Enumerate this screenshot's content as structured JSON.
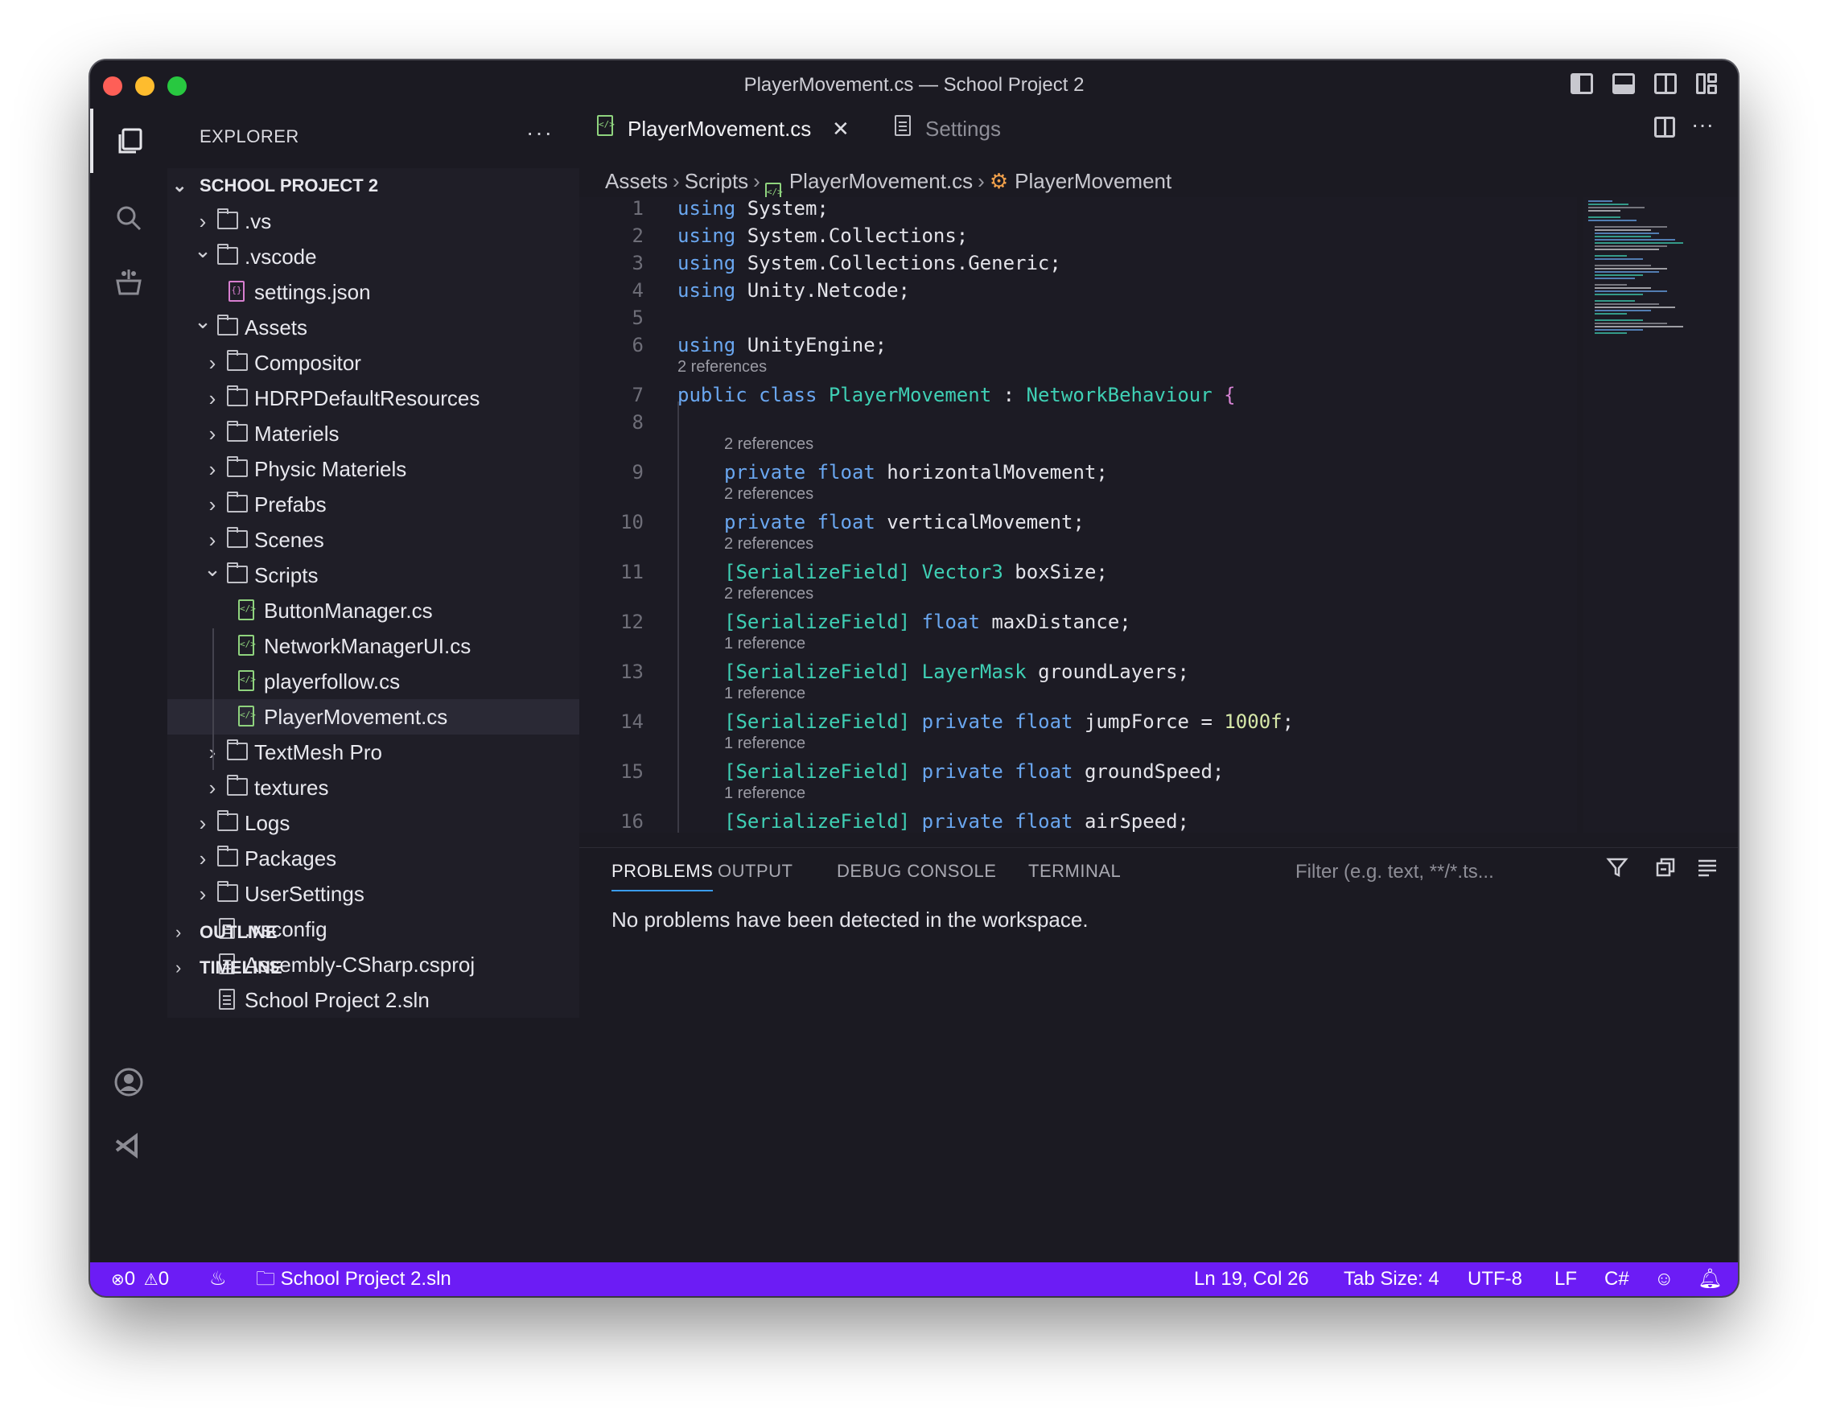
{
  "window": {
    "title": "PlayerMovement.cs — School Project 2"
  },
  "activity_bar": {
    "items": [
      "explorer-icon",
      "search-icon",
      "extensions-icon",
      "account-icon",
      "visual-studio-icon"
    ]
  },
  "explorer": {
    "header": "EXPLORER",
    "more": "···",
    "root": "SCHOOL PROJECT 2",
    "tree": [
      {
        "label": ".vs",
        "type": "folder",
        "expanded": false
      },
      {
        "label": ".vscode",
        "type": "folder",
        "expanded": true
      },
      {
        "label": "settings.json",
        "type": "json"
      },
      {
        "label": "Assets",
        "type": "folder",
        "expanded": true
      },
      {
        "label": "Compositor",
        "type": "folder",
        "expanded": false
      },
      {
        "label": "HDRPDefaultResources",
        "type": "folder",
        "expanded": false
      },
      {
        "label": "Materiels",
        "type": "folder",
        "expanded": false
      },
      {
        "label": "Physic Materiels",
        "type": "folder",
        "expanded": false
      },
      {
        "label": "Prefabs",
        "type": "folder",
        "expanded": false
      },
      {
        "label": "Scenes",
        "type": "folder",
        "expanded": false
      },
      {
        "label": "Scripts",
        "type": "folder",
        "expanded": true
      },
      {
        "label": "ButtonManager.cs",
        "type": "cs"
      },
      {
        "label": "NetworkManagerUI.cs",
        "type": "cs"
      },
      {
        "label": "playerfollow.cs",
        "type": "cs"
      },
      {
        "label": "PlayerMovement.cs",
        "type": "cs",
        "selected": true
      },
      {
        "label": "TextMesh Pro",
        "type": "folder",
        "expanded": false
      },
      {
        "label": "textures",
        "type": "folder",
        "expanded": false
      },
      {
        "label": "Logs",
        "type": "folder",
        "expanded": false
      },
      {
        "label": "Packages",
        "type": "folder",
        "expanded": false
      },
      {
        "label": "UserSettings",
        "type": "folder",
        "expanded": false
      },
      {
        "label": ".vsconfig",
        "type": "file"
      },
      {
        "label": "Assembly-CSharp.csproj",
        "type": "file"
      },
      {
        "label": "School Project 2.sln",
        "type": "file"
      }
    ],
    "outline": "OUTLINE",
    "timeline": "TIMELINE"
  },
  "editor": {
    "tabs": [
      {
        "label": "PlayerMovement.cs",
        "active": true,
        "close": "✕"
      },
      {
        "label": "Settings",
        "active": false
      }
    ],
    "breadcrumb": [
      "Assets",
      "Scripts",
      "PlayerMovement.cs",
      "PlayerMovement"
    ],
    "code": [
      {
        "n": "1",
        "kw": "using",
        "rest": " System;"
      },
      {
        "n": "2",
        "kw": "using",
        "rest": " System.Collections;"
      },
      {
        "n": "3",
        "kw": "using",
        "rest": " System.Collections.Generic;"
      },
      {
        "n": "4",
        "kw": "using",
        "rest": " Unity.Netcode;"
      },
      {
        "n": "5"
      },
      {
        "n": "6",
        "kw": "using",
        "rest": " UnityEngine;"
      },
      {
        "n": "7",
        "ref": "2 references"
      },
      {
        "n": "8"
      },
      {
        "n": "9",
        "ref": "2 references"
      },
      {
        "n": "10",
        "ref": "2 references"
      },
      {
        "n": "11",
        "ref": "2 references"
      },
      {
        "n": "12",
        "ref": "2 references"
      },
      {
        "n": "13",
        "ref": "1 reference"
      },
      {
        "n": "14",
        "ref": "1 reference"
      },
      {
        "n": "15",
        "ref": "1 reference"
      },
      {
        "n": "16",
        "ref": "1 reference"
      }
    ],
    "line7": {
      "kw1": "public",
      "kw2": "class",
      "name": "PlayerMovement",
      "colon": " : ",
      "base": "NetworkBehaviour",
      "brace": "{"
    },
    "line9": {
      "kw1": "private",
      "kw2": "float",
      "rest": " horizontalMovement;"
    },
    "line10": {
      "kw1": "private",
      "kw2": "float",
      "rest": " verticalMovement;"
    },
    "line11": {
      "attr": "[SerializeField]",
      "type": "Vector3",
      "rest": " boxSize;"
    },
    "line12": {
      "attr": "[SerializeField]",
      "kw": "float",
      "rest": " maxDistance;"
    },
    "line13": {
      "attr": "[SerializeField]",
      "type": "LayerMask",
      "rest": " groundLayers;"
    },
    "line14": {
      "attr": "[SerializeField]",
      "kw1": "private",
      "kw2": "float",
      "rest": " jumpForce = ",
      "num": "1000f",
      "end": ";"
    },
    "line15": {
      "attr": "[SerializeField]",
      "kw1": "private",
      "kw2": "float",
      "rest": " groundSpeed;"
    },
    "line16": {
      "attr": "[SerializeField]",
      "kw1": "private",
      "kw2": "float",
      "rest": " airSpeed;"
    }
  },
  "panel": {
    "tabs": [
      "PROBLEMS",
      "OUTPUT",
      "DEBUG CONSOLE",
      "TERMINAL"
    ],
    "filter_placeholder": "Filter (e.g. text, **/*.ts...",
    "message": "No problems have been detected in the workspace."
  },
  "status_bar": {
    "errors": "0",
    "warnings": "0",
    "solution": "School Project 2.sln",
    "position": "Ln 19, Col 26",
    "tab_size": "Tab Size: 4",
    "encoding": "UTF-8",
    "eol": "LF",
    "language": "C#",
    "background": "#6c1cf5"
  }
}
